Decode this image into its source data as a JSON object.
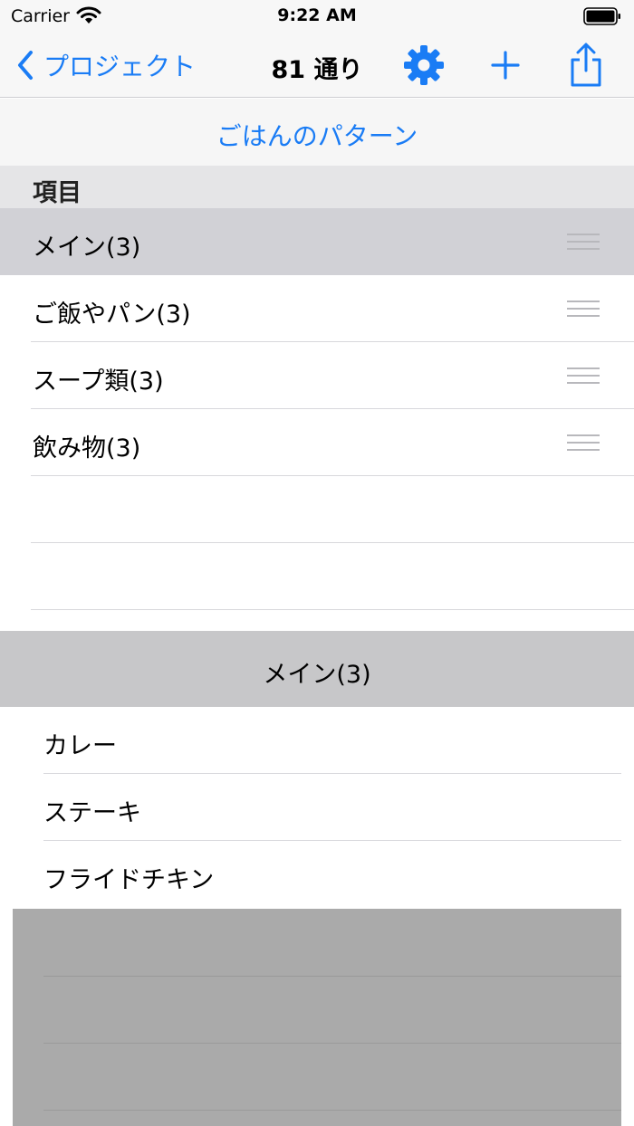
{
  "status_bar": {
    "carrier": "Carrier",
    "time": "9:22 AM",
    "wifi_icon": "wifi-icon",
    "battery_icon": "battery-icon"
  },
  "nav": {
    "back_label": "プロジェクト",
    "title": "81 通り",
    "settings_icon": "gear-icon",
    "add_icon": "plus-icon",
    "share_icon": "share-icon"
  },
  "subtitle": "ごはんのパターン",
  "section_header": "項目",
  "items": [
    {
      "label": "メイン(3)",
      "selected": true
    },
    {
      "label": "ご飯やパン(3)",
      "selected": false
    },
    {
      "label": "スープ類(3)",
      "selected": false
    },
    {
      "label": "飲み物(3)",
      "selected": false
    }
  ],
  "detail": {
    "header": "メイン(3)",
    "options": [
      "カレー",
      "ステーキ",
      "フライドチキン"
    ]
  },
  "colors": {
    "accent": "#1a7cf5",
    "selected_row": "#d1d1d6",
    "section_header": "#e5e5e7",
    "detail_header": "#c7c7c9",
    "overlay": "#aaaaaa"
  }
}
